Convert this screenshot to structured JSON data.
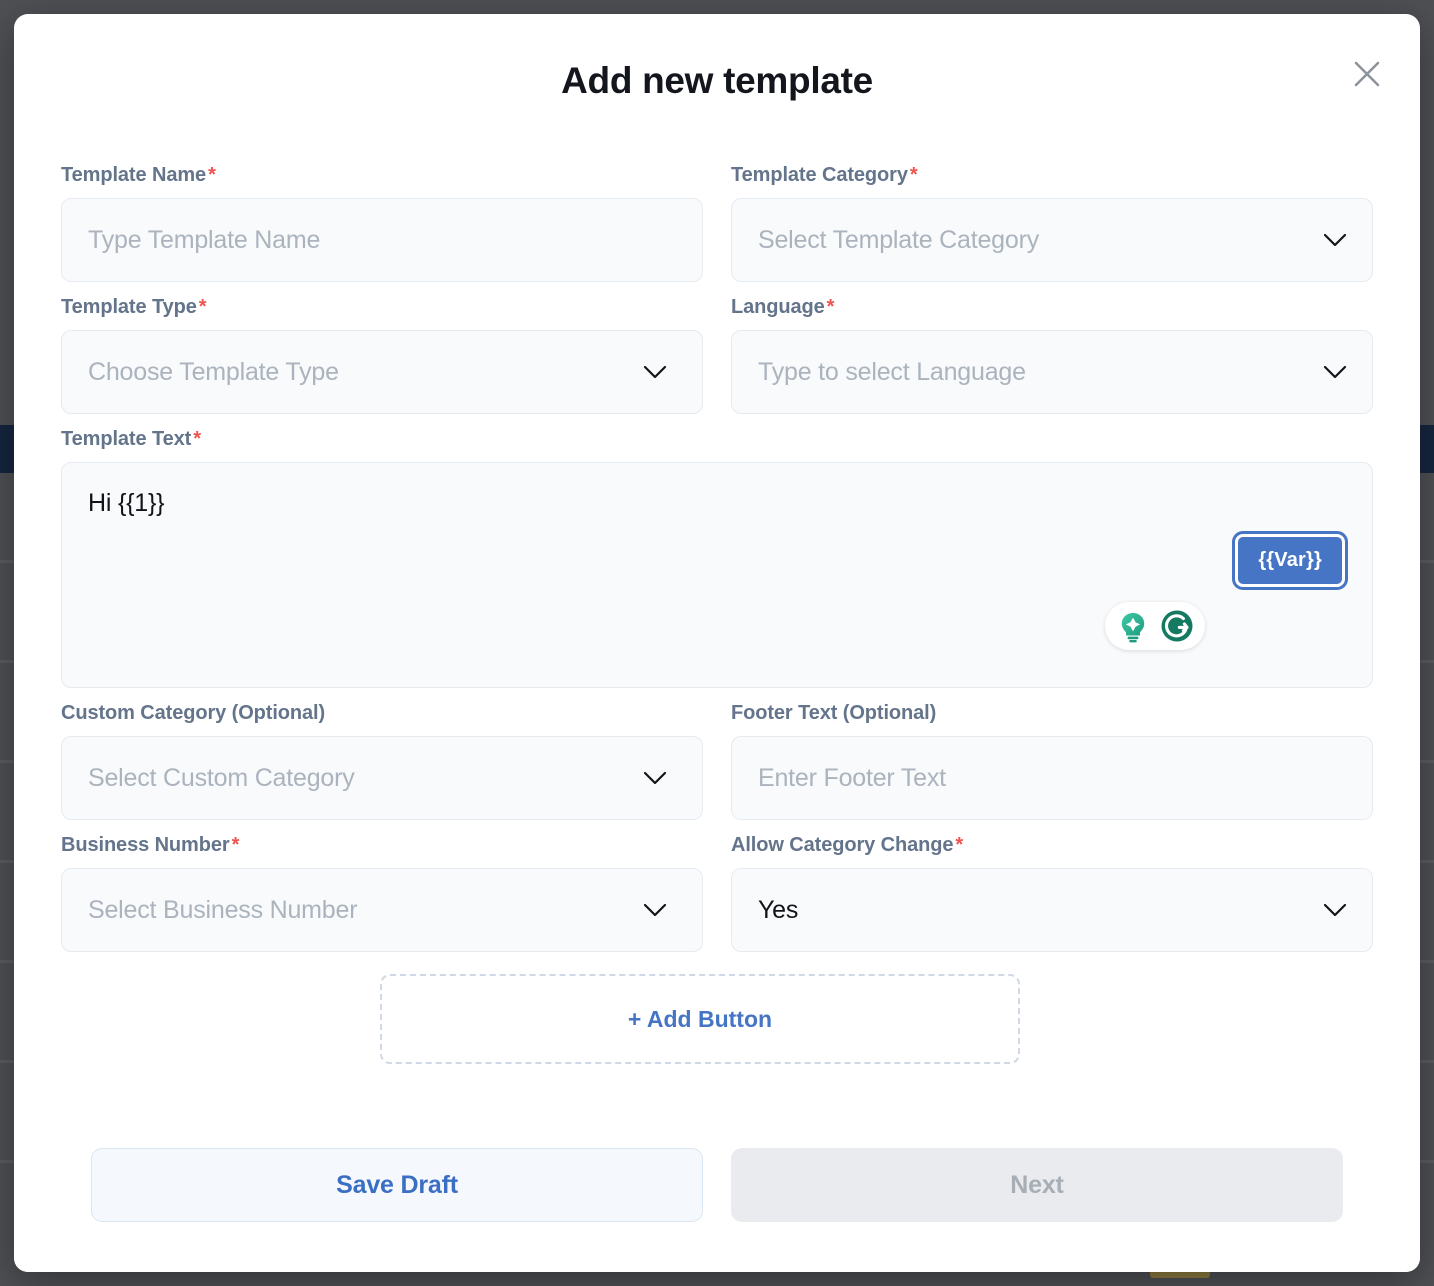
{
  "modal": {
    "title": "Add new template",
    "close_icon": "close-icon"
  },
  "form": {
    "template_name": {
      "label": "Template Name",
      "required_marker": "*",
      "placeholder": "Type Template Name",
      "value": ""
    },
    "template_category": {
      "label": "Template Category",
      "required_marker": "*",
      "placeholder": "Select Template Category",
      "value": "",
      "chevron_icon": "chevron-down-icon"
    },
    "template_type": {
      "label": "Template Type",
      "required_marker": "*",
      "placeholder": "Choose Template Type",
      "value": "",
      "chevron_icon": "chevron-down-icon"
    },
    "language": {
      "label": "Language",
      "required_marker": "*",
      "placeholder": "Type to select Language",
      "value": "",
      "chevron_icon": "chevron-down-icon"
    },
    "template_text": {
      "label": "Template Text",
      "required_marker": "*",
      "value": "Hi {{1}}",
      "var_button_label": "{{Var}}",
      "assistant": {
        "name": "grammarly-widget",
        "bulb_icon": "lightbulb-icon",
        "logo_icon": "grammarly-logo-icon"
      }
    },
    "custom_category": {
      "label": "Custom Category (Optional)",
      "placeholder": "Select Custom Category",
      "value": "",
      "chevron_icon": "chevron-down-icon"
    },
    "footer_text": {
      "label": "Footer Text (Optional)",
      "placeholder": "Enter Footer Text",
      "value": ""
    },
    "business_number": {
      "label": "Business Number",
      "required_marker": "*",
      "placeholder": "Select Business Number",
      "value": "",
      "chevron_icon": "chevron-down-icon"
    },
    "allow_category_change": {
      "label": "Allow Category Change",
      "required_marker": "*",
      "value": "Yes",
      "chevron_icon": "chevron-down-icon"
    },
    "add_button": {
      "label": "+ Add Button"
    }
  },
  "footer": {
    "save_draft_label": "Save Draft",
    "next_label": "Next"
  },
  "colors": {
    "accent_blue": "#4575c4",
    "required_red": "#ef5350",
    "label_slate": "#64748b",
    "field_bg": "#f8fafc",
    "disabled_bg": "#e9ebee",
    "grammarly_green": "#15806a",
    "backdrop": "#4e5054"
  }
}
